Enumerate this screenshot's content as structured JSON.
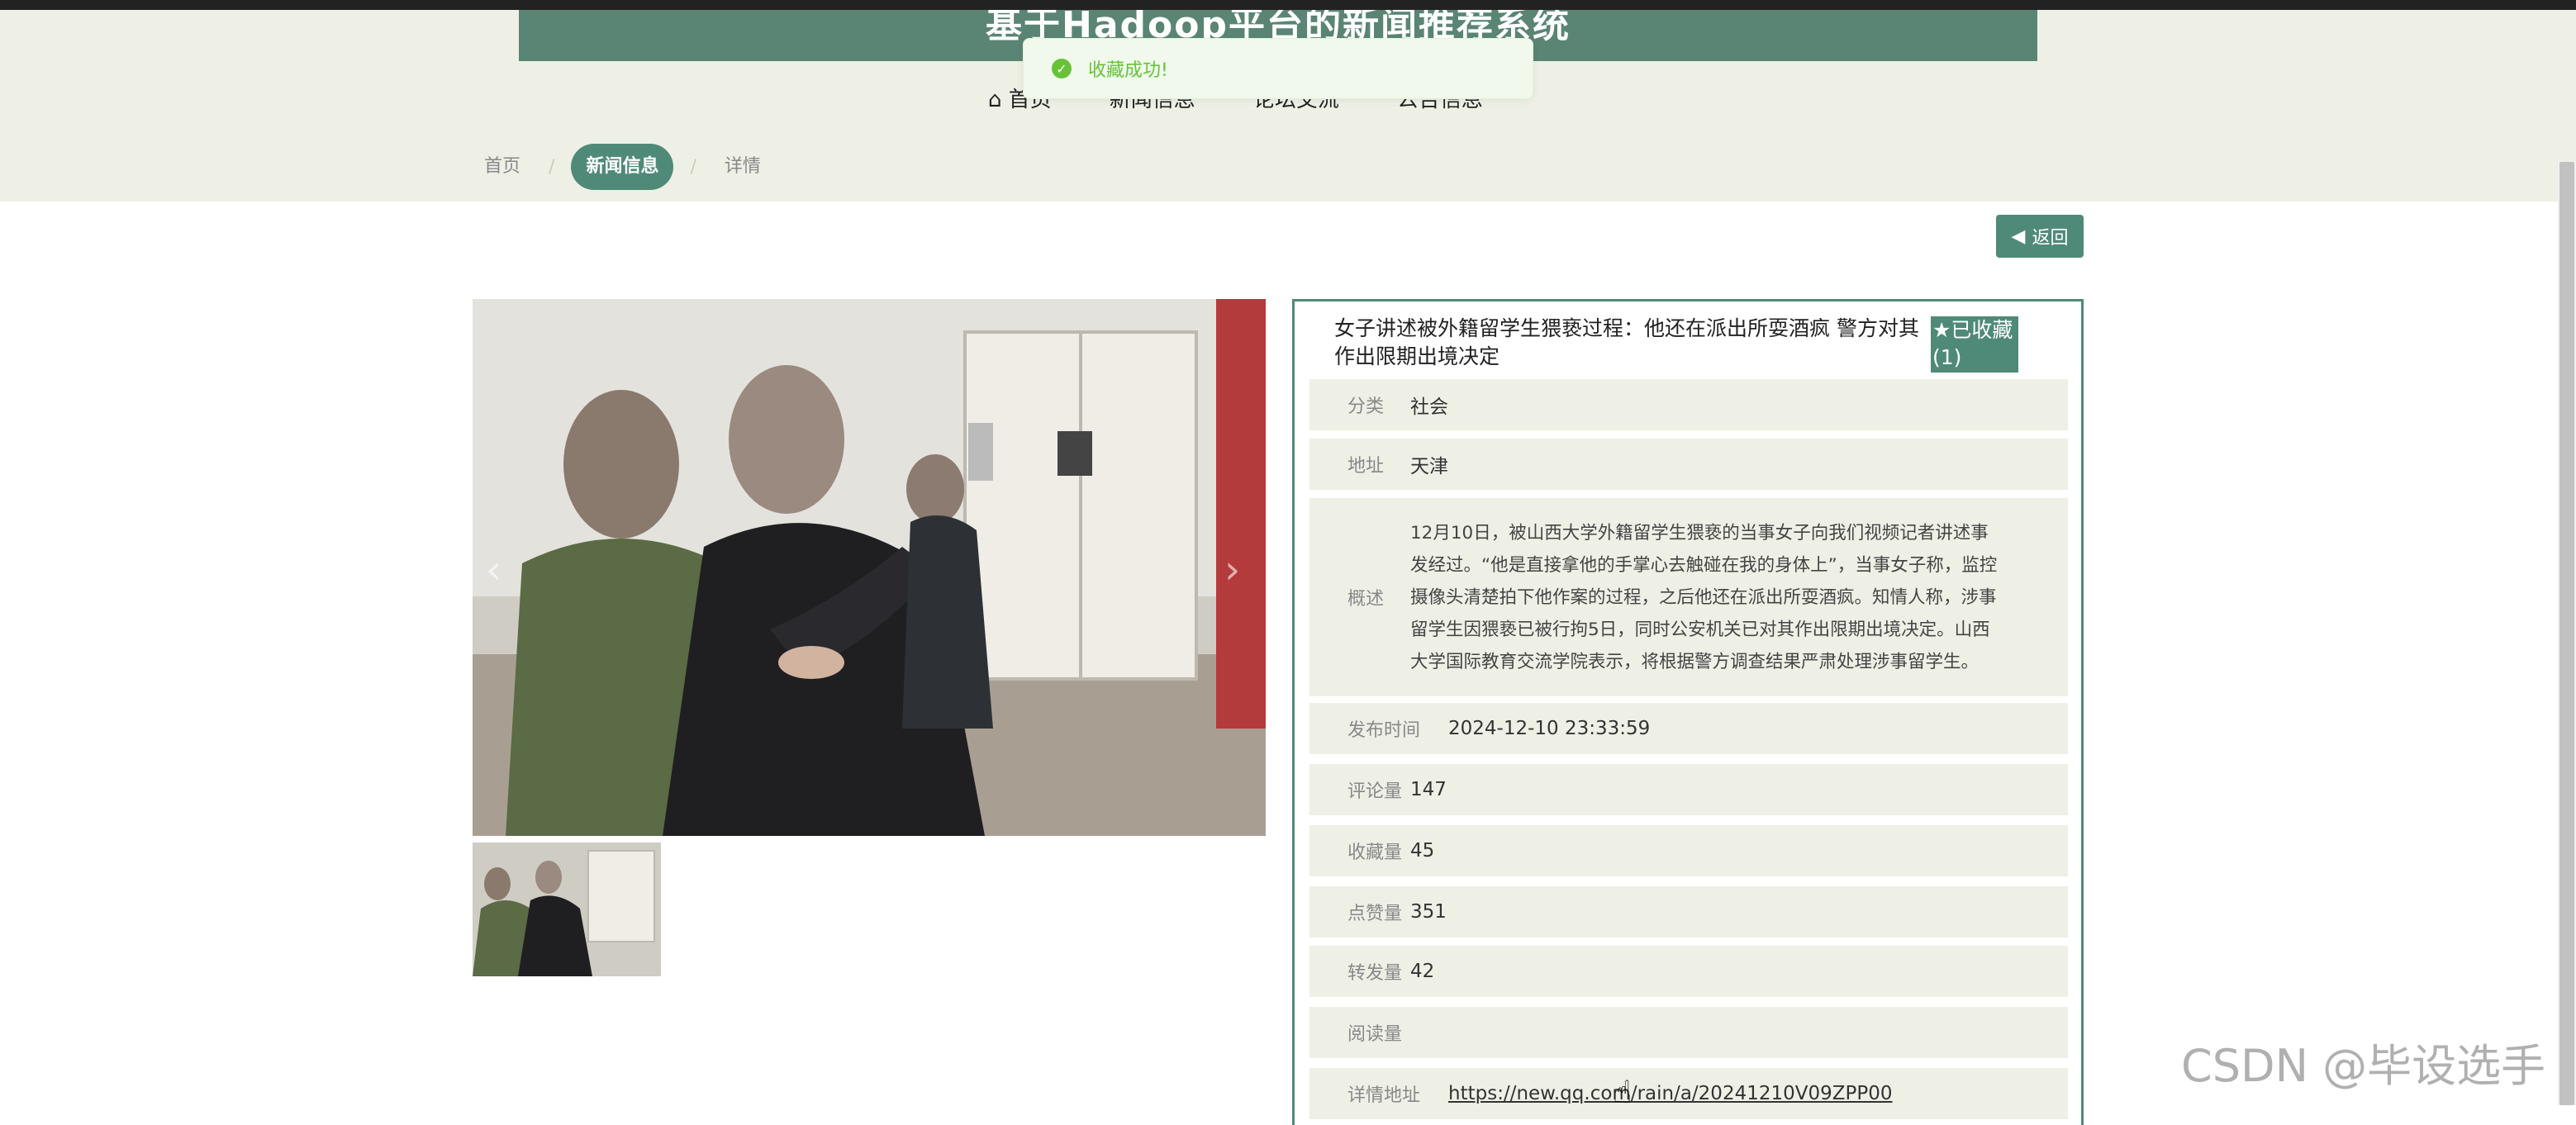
{
  "header": {
    "title": "基于Hadoop平台的新闻推荐系统",
    "nav": [
      "首页",
      "新闻信息",
      "论坛交流",
      "公告信息"
    ]
  },
  "toast": {
    "message": "收藏成功!"
  },
  "breadcrumb": {
    "home": "首页",
    "news": "新闻信息",
    "detail": "详情",
    "separator": "/"
  },
  "back_button": {
    "label": "返回"
  },
  "article": {
    "title": "女子讲述被外籍留学生猥亵过程：他还在派出所耍酒疯 警方对其作出限期出境决定",
    "favorite_label": "已收藏",
    "favorite_count": "(1)",
    "fields": {
      "category": {
        "label": "分类",
        "value": "社会"
      },
      "address": {
        "label": "地址",
        "value": "天津"
      },
      "summary": {
        "label": "概述",
        "value": "12月10日，被山西大学外籍留学生猥亵的当事女子向我们视频记者讲述事发经过。“他是直接拿他的手掌心去触碰在我的身体上”，当事女子称，监控摄像头清楚拍下他作案的过程，之后他还在派出所耍酒疯。知情人称，涉事留学生因猥亵已被行拘5日，同时公安机关已对其作出限期出境决定。山西大学国际教育交流学院表示，将根据警方调查结果严肃处理涉事留学生。"
      },
      "publish_time": {
        "label": "发布时间",
        "value": "2024-12-10 23:33:59"
      },
      "comments": {
        "label": "评论量",
        "value": "147"
      },
      "favorites": {
        "label": "收藏量",
        "value": "45"
      },
      "likes": {
        "label": "点赞量",
        "value": "351"
      },
      "shares": {
        "label": "转发量",
        "value": "42"
      },
      "reads": {
        "label": "阅读量",
        "value": ""
      },
      "detail_url": {
        "label": "详情地址",
        "value": "https://new.qq.com/rain/a/20241210V09ZPP00"
      }
    }
  },
  "watermark": "CSDN @毕设选手",
  "colors": {
    "accent": "#4f8a78",
    "band": "#eef0e6",
    "toast_text": "#67c23a"
  },
  "icons": {
    "toast": "check-circle-icon",
    "back": "caret-left-icon",
    "favorite": "star-icon",
    "nav_home": "home-icon"
  }
}
